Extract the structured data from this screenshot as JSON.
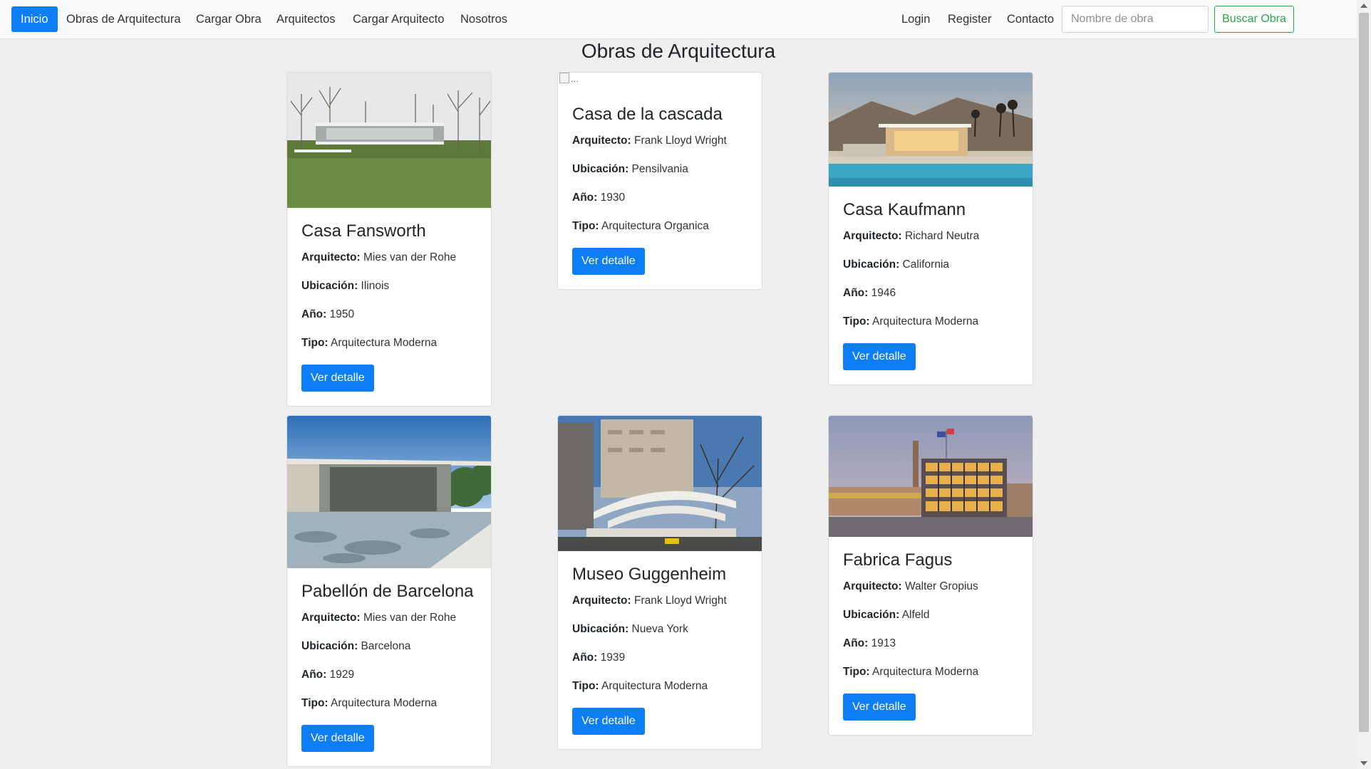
{
  "nav": {
    "links": [
      "Inicio",
      "Obras de Arquitectura",
      "Cargar Obra",
      "Arquitectos",
      "Cargar Arquitecto",
      "Nosotros"
    ],
    "right_links": [
      "Login",
      "Register",
      "Contacto"
    ],
    "search_placeholder": "Nombre de obra",
    "search_button": "Buscar Obra"
  },
  "page": {
    "title": "Obras de Arquitectura"
  },
  "labels": {
    "arquitecto": "Arquitecto:",
    "ubicacion": "Ubicación:",
    "anio": "Año:",
    "tipo": "Tipo:",
    "detail_button": "Ver detalle",
    "broken_image_alt": "..."
  },
  "cards": [
    {
      "title": "Casa Fansworth",
      "arquitecto": "Mies van der Rohe",
      "ubicacion": "Ilinois",
      "anio": "1950",
      "tipo": "Arquitectura Moderna"
    },
    {
      "title": "Casa de la cascada",
      "arquitecto": "Frank Lloyd Wright",
      "ubicacion": "Pensilvania",
      "anio": "1930",
      "tipo": "Arquitectura Organica"
    },
    {
      "title": "Casa Kaufmann",
      "arquitecto": "Richard Neutra",
      "ubicacion": "California",
      "anio": "1946",
      "tipo": "Arquitectura Moderna"
    },
    {
      "title": "Pabellón de Barcelona",
      "arquitecto": "Mies van der Rohe",
      "ubicacion": "Barcelona",
      "anio": "1929",
      "tipo": "Arquitectura Moderna"
    },
    {
      "title": "Museo Guggenheim",
      "arquitecto": "Frank Lloyd Wright",
      "ubicacion": "Nueva York",
      "anio": "1939",
      "tipo": "Arquitectura Moderna"
    },
    {
      "title": "Fabrica Fagus",
      "arquitecto": "Walter Gropius",
      "ubicacion": "Alfeld",
      "anio": "1913",
      "tipo": "Arquitectura Moderna"
    }
  ],
  "colors": {
    "primary": "#0d7ef5",
    "success": "#28a745",
    "navbar_bg": "#f8f9fa",
    "page_bg": "#efefef"
  }
}
